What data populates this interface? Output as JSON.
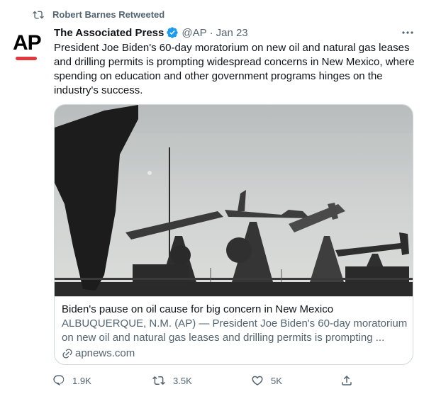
{
  "social_context": {
    "icon": "retweet-icon",
    "text": "Robert Barnes Retweeted"
  },
  "tweet": {
    "avatar": {
      "logo_text": "AP",
      "accent_color": "#e03a3e"
    },
    "author": {
      "display_name": "The Associated Press",
      "verified": true,
      "handle": "@AP",
      "separator": "·",
      "date": "Jan 23"
    },
    "text": "President Joe Biden's 60-day moratorium on new oil and natural gas leases and drilling permits is prompting widespread concerns in New Mexico, where spending on education and other government programs hinges on the industry's success.",
    "card": {
      "image_alt": "Oil pumpjacks silhouetted against a pale sky",
      "title": "Biden's pause on oil cause for big concern in New Mexico",
      "description": "ALBUQUERQUE, N.M. (AP) — President Joe Biden's 60-day moratorium on new oil and natural gas leases and drilling permits is prompting ...",
      "domain": "apnews.com"
    },
    "actions": {
      "reply_count": "1.9K",
      "retweet_count": "3.5K",
      "like_count": "5K"
    }
  },
  "colors": {
    "text_primary": "#0f1419",
    "text_secondary": "#536471",
    "border": "#cfd9de",
    "verified_blue": "#1d9bf0"
  }
}
